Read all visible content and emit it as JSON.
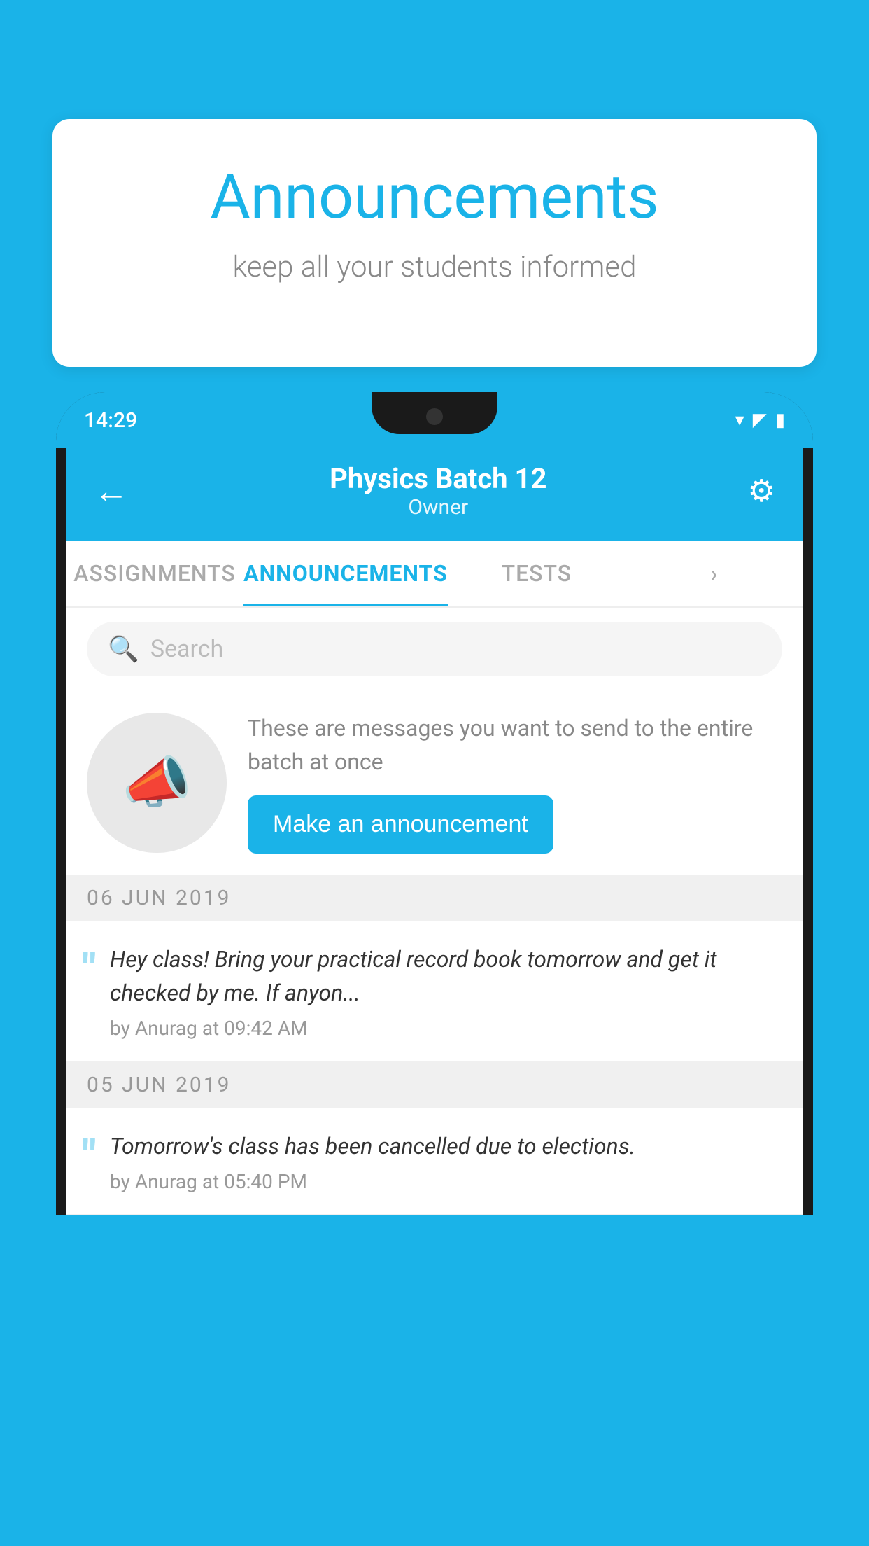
{
  "bubble": {
    "title": "Announcements",
    "subtitle": "keep all your students informed"
  },
  "status_bar": {
    "time": "14:29",
    "wifi": "▾",
    "signal": "▲",
    "battery": "▮"
  },
  "header": {
    "title": "Physics Batch 12",
    "subtitle": "Owner",
    "back_label": "←",
    "gear_label": "⚙"
  },
  "tabs": [
    {
      "label": "ASSIGNMENTS",
      "active": false
    },
    {
      "label": "ANNOUNCEMENTS",
      "active": true
    },
    {
      "label": "TESTS",
      "active": false
    },
    {
      "label": "...",
      "active": false
    }
  ],
  "search": {
    "placeholder": "Search"
  },
  "announcement_prompt": {
    "description": "These are messages you want to send to the entire batch at once",
    "button_label": "Make an announcement"
  },
  "announcements": [
    {
      "date": "06  JUN  2019",
      "text": "Hey class! Bring your practical record book tomorrow and get it checked by me. If anyon...",
      "meta": "by Anurag at 09:42 AM"
    },
    {
      "date": "05  JUN  2019",
      "text": "Tomorrow's class has been cancelled due to elections.",
      "meta": "by Anurag at 05:40 PM"
    }
  ],
  "colors": {
    "primary": "#1ab3e8",
    "bg": "#1ab3e8",
    "white": "#ffffff",
    "text_dark": "#333333",
    "text_gray": "#888888",
    "tab_inactive": "#aaaaaa",
    "separator_bg": "#f0f0f0"
  }
}
